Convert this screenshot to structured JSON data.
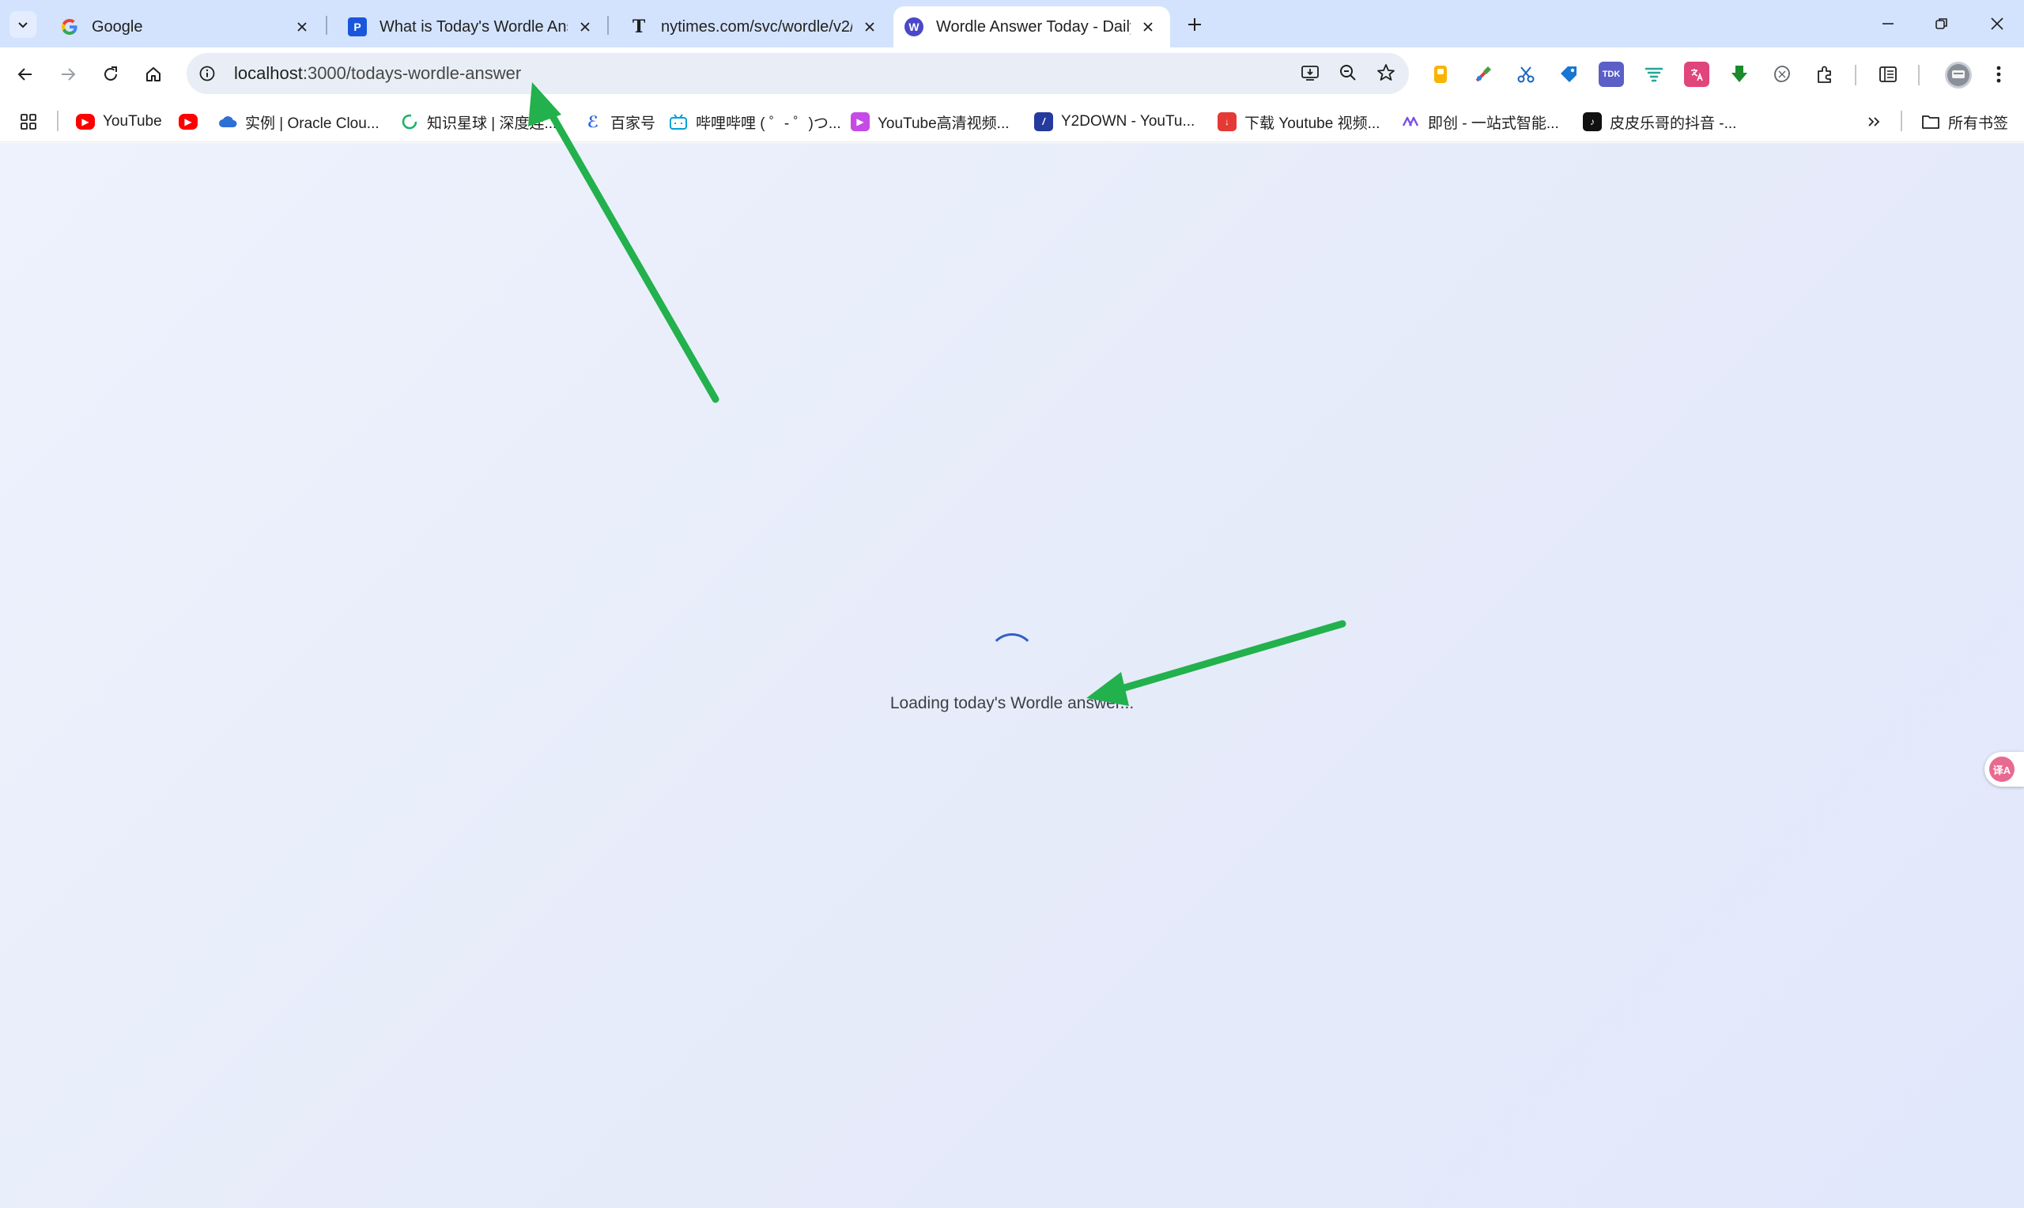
{
  "tabs": [
    {
      "title": "Google",
      "favicon": "google-icon",
      "active": false
    },
    {
      "title": "What is Today's Wordle Answ",
      "favicon": "p-icon",
      "active": false
    },
    {
      "title": "nytimes.com/svc/wordle/v2/",
      "favicon": "nyt-icon",
      "active": false
    },
    {
      "title": "Wordle Answer Today - Daily",
      "favicon": "w-icon",
      "active": true
    }
  ],
  "toolbar": {
    "url_host": "localhost",
    "url_path": ":3000/todays-wordle-answer"
  },
  "extensions": {
    "tdk_label": "TDK"
  },
  "bookmarks": {
    "items": [
      {
        "label": "YouTube",
        "icon": "youtube-icon"
      },
      {
        "label": "",
        "icon": "youtube-icon"
      },
      {
        "label": "实例 | Oracle Clou...",
        "icon": "cloud-icon"
      },
      {
        "label": "知识星球 | 深度连...",
        "icon": "zsxq-icon"
      },
      {
        "label": "百家号",
        "icon": "baijiahao-icon"
      },
      {
        "label": "哔哩哔哩 ( ゜- ゜)つ...",
        "icon": "bilibili-icon"
      },
      {
        "label": "YouTube高清视频...",
        "icon": "video-icon"
      },
      {
        "label": "Y2DOWN - YouTu...",
        "icon": "y2down-icon"
      },
      {
        "label": "下载 Youtube 视频...",
        "icon": "download-icon"
      },
      {
        "label": "即创 - 一站式智能...",
        "icon": "jichuang-icon"
      },
      {
        "label": "皮皮乐哥的抖音 -...",
        "icon": "douyin-icon"
      }
    ],
    "all_bookmarks": "所有书签"
  },
  "page": {
    "loading_text": "Loading today's Wordle answer..."
  },
  "floating": {
    "translate_label": "译A"
  },
  "colors": {
    "tabstrip": "#d3e3fd",
    "omnibox": "#e9eef6",
    "page_bg": "#e8edfb",
    "spinner": "#2f5fc4",
    "annotation_arrow": "#22b14c"
  }
}
